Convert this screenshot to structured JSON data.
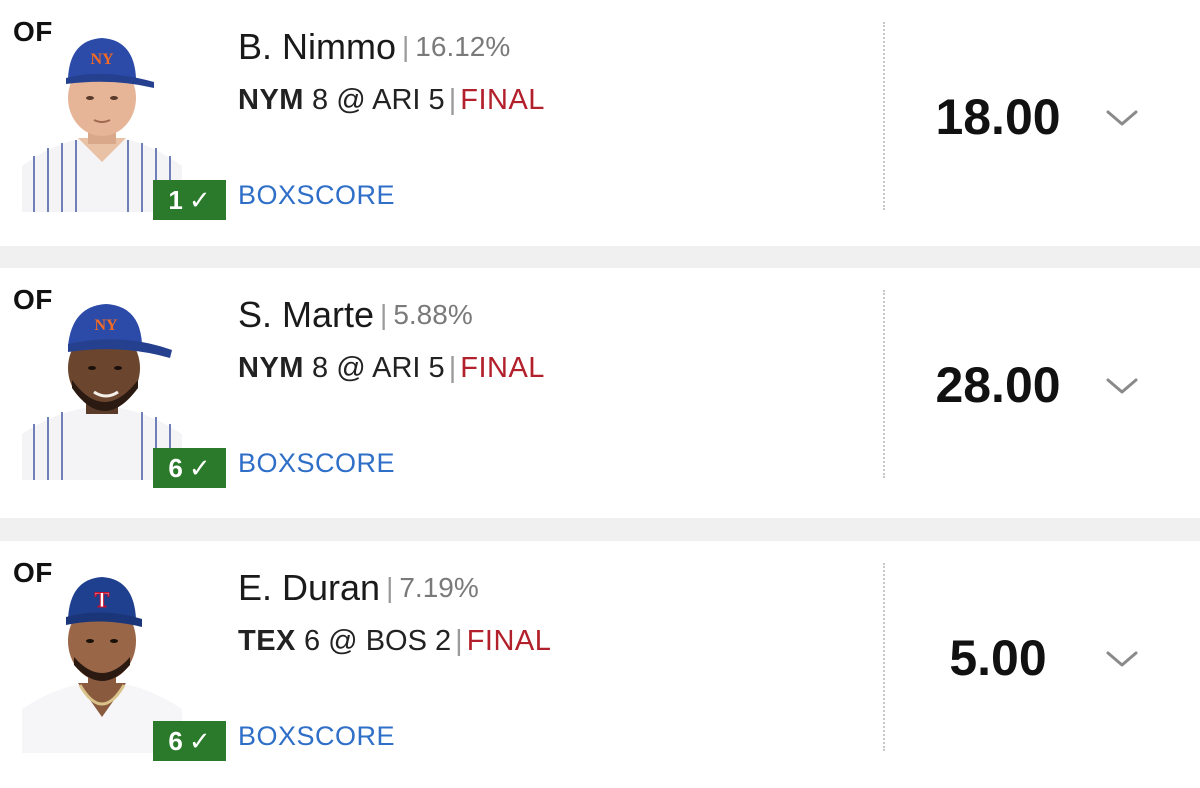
{
  "players": [
    {
      "position": "OF",
      "name": "B. Nimmo",
      "ownership": "16.12%",
      "team": "NYM",
      "team_score": "8",
      "at": "@",
      "opp": "ARI",
      "opp_score": "5",
      "status": "FINAL",
      "rank": "1",
      "boxscore": "BOXSCORE",
      "points": "18.00",
      "cap_logo": "NY"
    },
    {
      "position": "OF",
      "name": "S. Marte",
      "ownership": "5.88%",
      "team": "NYM",
      "team_score": "8",
      "at": "@",
      "opp": "ARI",
      "opp_score": "5",
      "status": "FINAL",
      "rank": "6",
      "boxscore": "BOXSCORE",
      "points": "28.00",
      "cap_logo": "NY"
    },
    {
      "position": "OF",
      "name": "E. Duran",
      "ownership": "7.19%",
      "team": "TEX",
      "team_score": "6",
      "at": "@",
      "opp": "BOS",
      "opp_score": "2",
      "status": "FINAL",
      "rank": "6",
      "boxscore": "BOXSCORE",
      "points": "5.00",
      "cap_logo": "T"
    }
  ],
  "icons": {
    "check": "check-icon",
    "chevron": "chevron-down-icon"
  },
  "colors": {
    "badge": "#2b7a2b",
    "final": "#b2202c",
    "link": "#2f6fc8",
    "mets_cap": "#2c4aa8",
    "rangers_cap": "#1f3f8f"
  }
}
